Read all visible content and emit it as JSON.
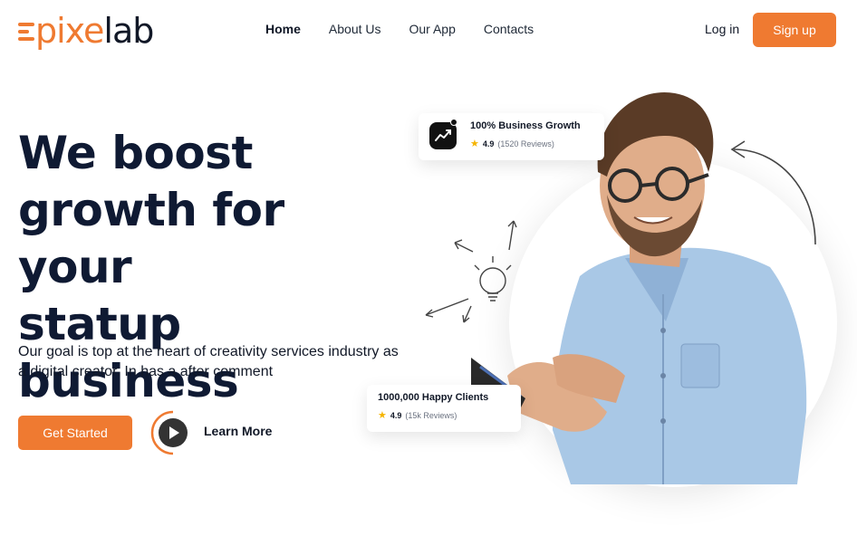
{
  "brand": {
    "logo_text_orange": "pixe",
    "logo_text_dark": "lab",
    "accent": "#ef7a31"
  },
  "nav": {
    "items": [
      {
        "label": "Home",
        "active": true
      },
      {
        "label": "About Us",
        "active": false
      },
      {
        "label": "Our App",
        "active": false
      },
      {
        "label": "Contacts",
        "active": false
      }
    ],
    "login_label": "Log in",
    "signup_label": "Sign up"
  },
  "hero": {
    "headline_line1": "We boost",
    "headline_line2": "growth for your",
    "headline_line3": "statup business",
    "subtext": "Our goal is top at the heart of creativity services industry as a digital creator. In has a after comment",
    "cta_primary": "Get Started",
    "cta_secondary": "Learn More"
  },
  "cards": {
    "growth": {
      "title": "100% Business Growth",
      "score": "4.9",
      "reviews": "(1520 Reviews)",
      "icon": "chart-icon"
    },
    "clients": {
      "title": "1000,000 Happy Clients",
      "score": "4.9",
      "reviews": "(15k Reviews)"
    }
  }
}
